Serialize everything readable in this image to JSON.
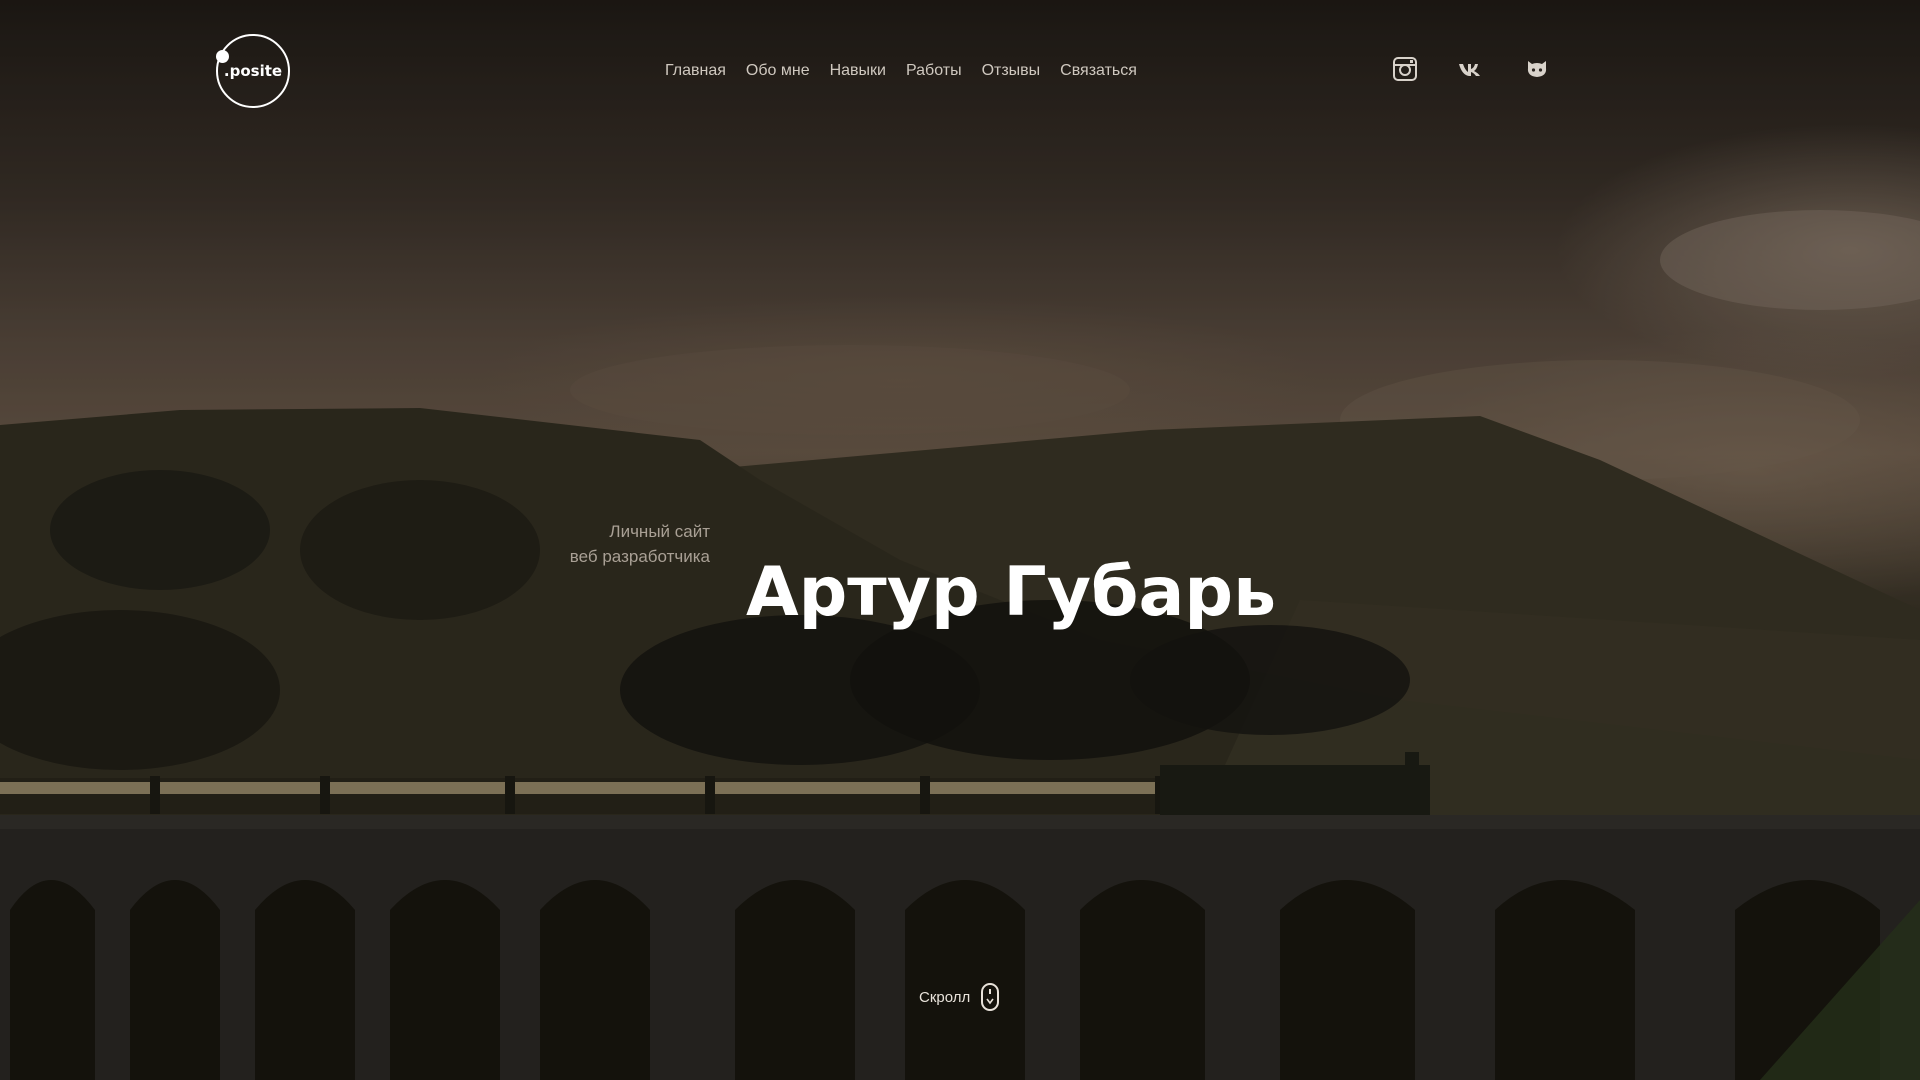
{
  "header": {
    "logo_text": ".posite",
    "nav": [
      {
        "label": "Главная"
      },
      {
        "label": "Обо мне"
      },
      {
        "label": "Навыки"
      },
      {
        "label": "Работы"
      },
      {
        "label": "Отзывы"
      },
      {
        "label": "Связаться"
      }
    ],
    "social": [
      {
        "icon": "instagram-icon"
      },
      {
        "icon": "vk-icon"
      },
      {
        "icon": "github-icon"
      }
    ]
  },
  "hero": {
    "subtitle_line1": "Личный сайт",
    "subtitle_line2": "веб разработчика",
    "name": "Артур Губарь"
  },
  "scroll": {
    "label": "Скролл",
    "icon": "mouse-icon"
  },
  "colors": {
    "text_primary": "#ffffff",
    "nav_text": "#cfc8bf",
    "subtitle_text": "#a9a095"
  }
}
